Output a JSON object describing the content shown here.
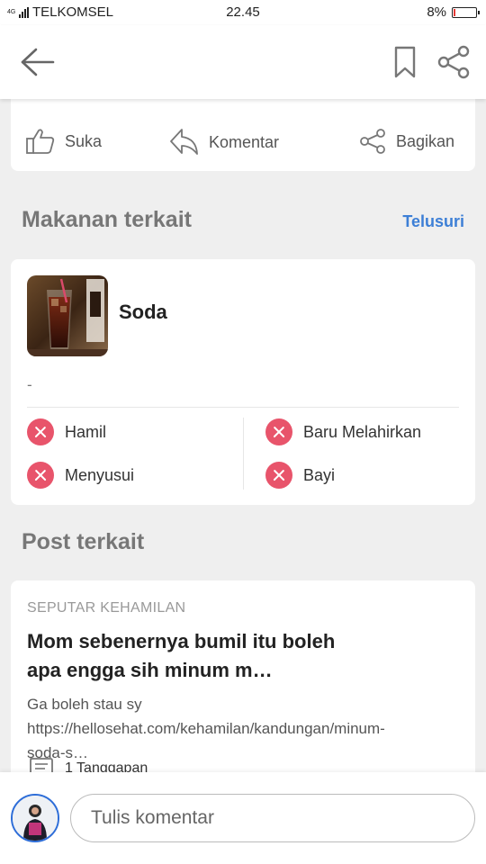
{
  "status_bar": {
    "network_label": "4G",
    "carrier": "TELKOMSEL",
    "time": "22.45",
    "battery_text": "8%",
    "battery_level": 0.08,
    "battery_color": "#e53935"
  },
  "header": {
    "back_icon": "arrow-left-icon",
    "bookmark_icon": "bookmark-icon",
    "share_icon": "share-icon"
  },
  "post_actions": {
    "like_label": "Suka",
    "comment_label": "Komentar",
    "share_label": "Bagikan"
  },
  "related_food": {
    "title": "Makanan terkait",
    "explore_label": "Telusuri",
    "explore_color": "#3d7fd6",
    "item": {
      "name": "Soda",
      "description": "-",
      "safety": [
        {
          "label": "Hamil",
          "status": "not-safe"
        },
        {
          "label": "Baru Melahirkan",
          "status": "not-safe"
        },
        {
          "label": "Menyusui",
          "status": "not-safe"
        },
        {
          "label": "Bayi",
          "status": "not-safe"
        }
      ],
      "not_safe_color": "#e8546b"
    }
  },
  "related_posts": {
    "title": "Post terkait",
    "items": [
      {
        "category": "SEPUTAR KEHAMILAN",
        "title": "Mom sebenernya bumil itu boleh apa engga sih minum m…",
        "excerpt": "Ga boleh stau sy https://hellosehat.com/kehamilan/kandungan/minum-soda-s…",
        "replies": "1 Tanggapan"
      }
    ]
  },
  "comment_bar": {
    "placeholder": "Tulis komentar"
  }
}
